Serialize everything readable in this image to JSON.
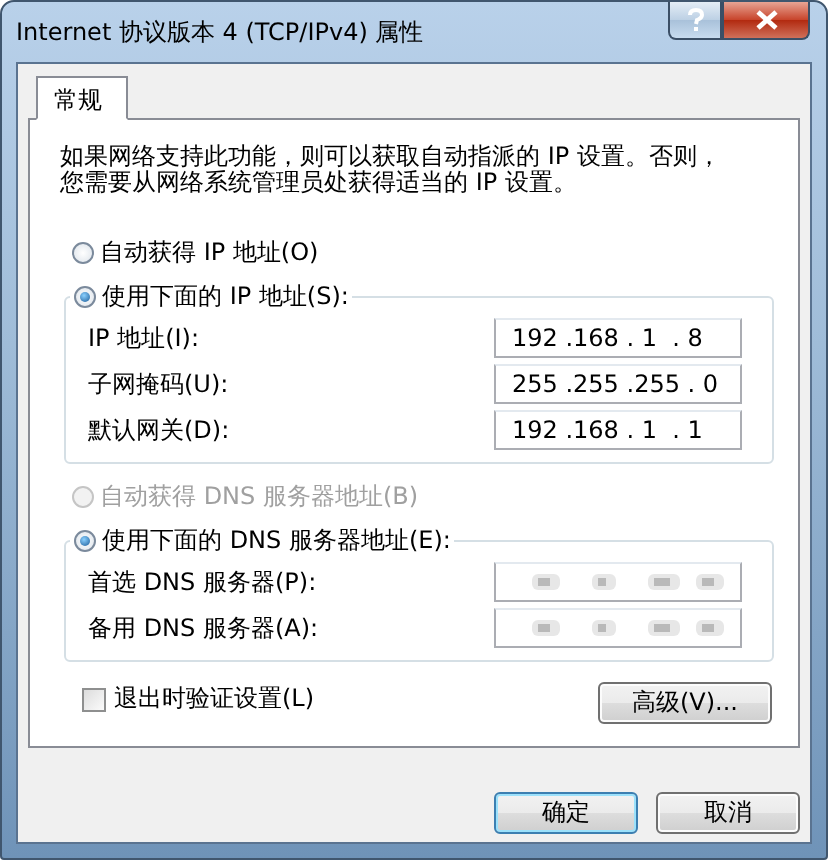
{
  "window": {
    "title": "Internet 协议版本 4 (TCP/IPv4) 属性"
  },
  "tabs": [
    {
      "label": "常规",
      "selected": true
    }
  ],
  "description": "如果网络支持此功能，则可以获取自动指派的 IP 设置。否则，您需要从网络系统管理员处获得适当的 IP 设置。",
  "ip_section": {
    "auto_option": {
      "label": "自动获得 IP 地址(O)",
      "selected": false,
      "disabled": false
    },
    "manual_option": {
      "label": "使用下面的 IP 地址(S):",
      "selected": true,
      "disabled": false
    },
    "fields": [
      {
        "label": "IP 地址(I):",
        "value": "192 .168 . 1  . 8",
        "blurred": false
      },
      {
        "label": "子网掩码(U):",
        "value": "255 .255 .255 . 0",
        "blurred": false
      },
      {
        "label": "默认网关(D):",
        "value": "192 .168 . 1  . 1",
        "blurred": false
      }
    ]
  },
  "dns_section": {
    "auto_option": {
      "label": "自动获得 DNS 服务器地址(B)",
      "selected": false,
      "disabled": true
    },
    "manual_option": {
      "label": "使用下面的 DNS 服务器地址(E):",
      "selected": true,
      "disabled": false
    },
    "fields": [
      {
        "label": "首选 DNS 服务器(P):",
        "blurred": true
      },
      {
        "label": "备用 DNS 服务器(A):",
        "blurred": true
      }
    ]
  },
  "validate_checkbox": {
    "label": "退出时验证设置(L)",
    "checked": false
  },
  "advanced_button": "高级(V)...",
  "buttons": [
    {
      "label": "确定",
      "default": true
    },
    {
      "label": "取消",
      "default": false
    }
  ]
}
